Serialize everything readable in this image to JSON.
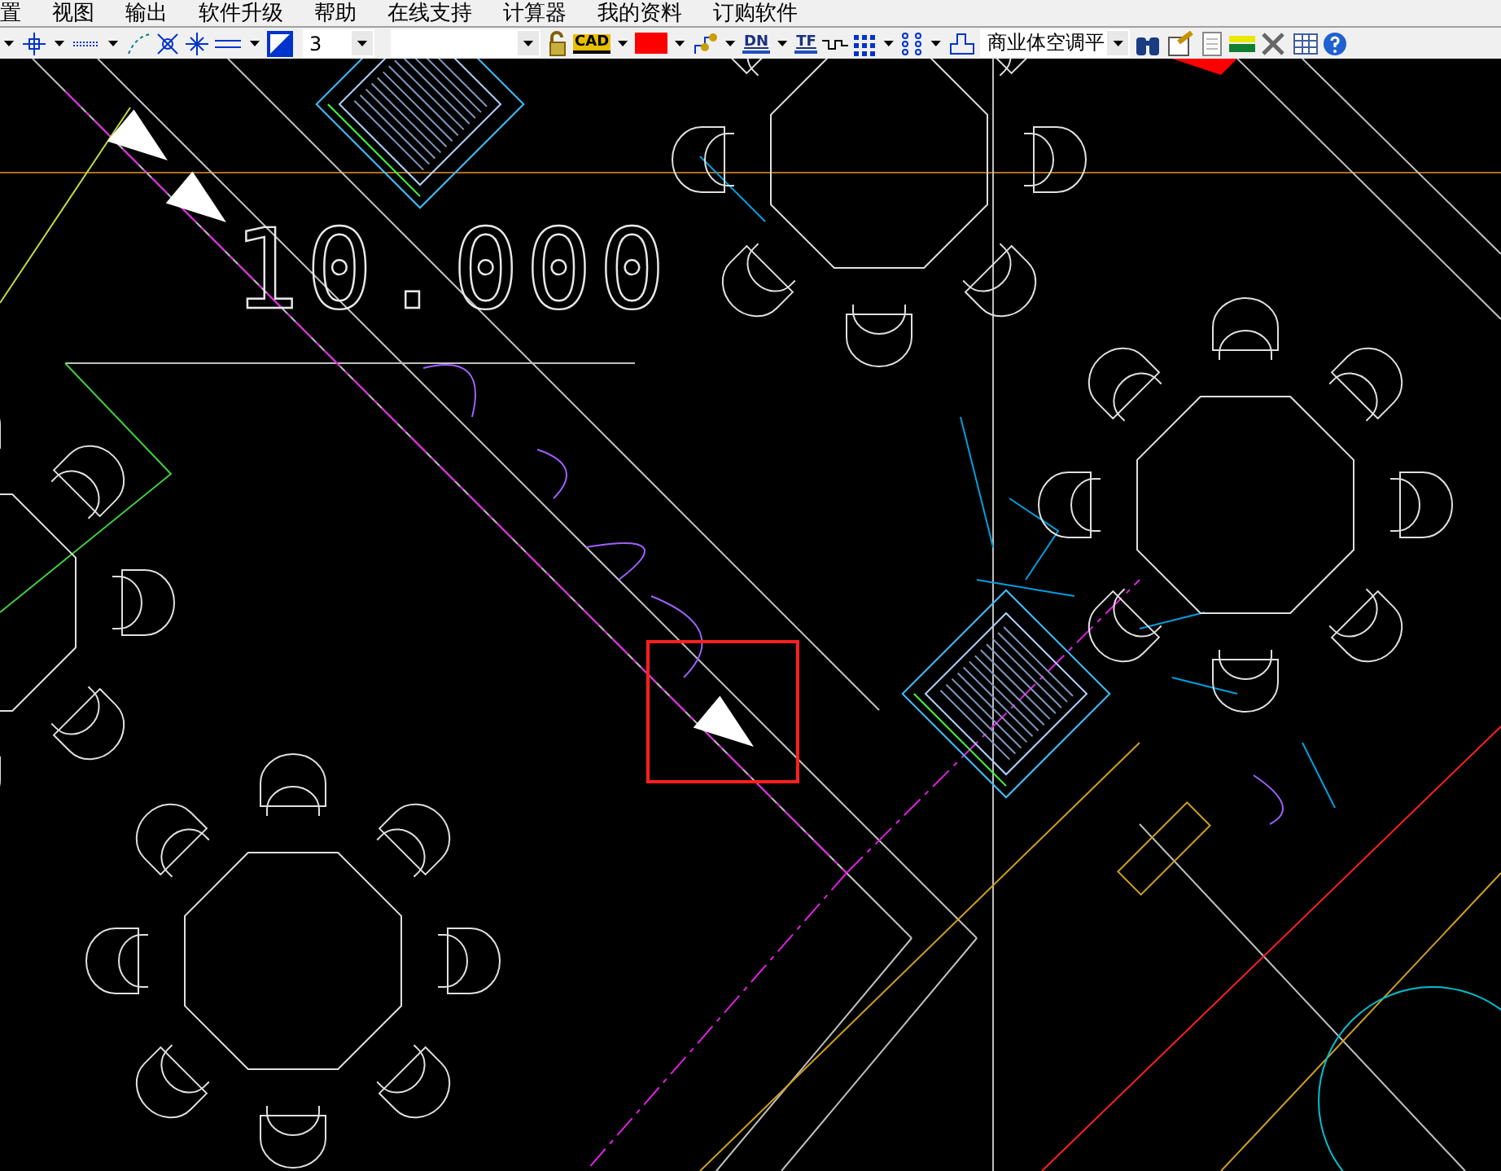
{
  "menu": [
    "置",
    "视图",
    "输出",
    "软件升级",
    "帮助",
    "在线支持",
    "计算器",
    "我的资料",
    "订购软件"
  ],
  "toolbar": {
    "scale_combo": "3",
    "cad_label": "CAD",
    "dn_label": "DN",
    "tf_label": "TF",
    "system_combo": "商业体空调平"
  },
  "canvas": {
    "elevation_text": "10.000"
  }
}
